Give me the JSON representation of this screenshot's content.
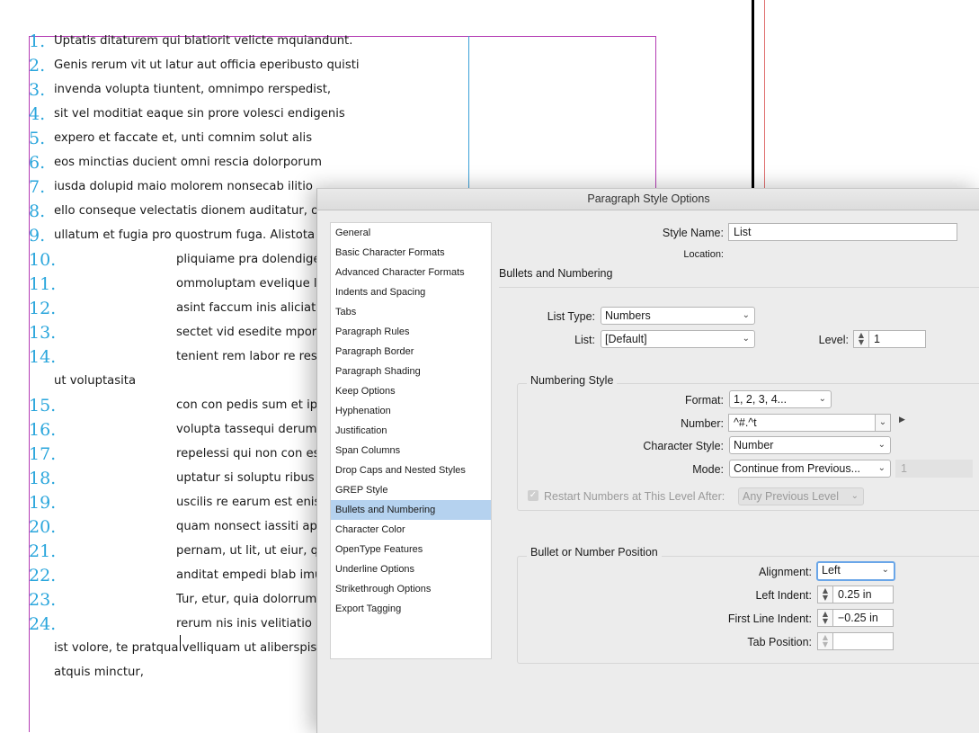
{
  "document": {
    "list_items": [
      {
        "number": "1.",
        "text": "Uptatis ditaturem qui blatiorit velicte mquiandunt."
      },
      {
        "number": "2.",
        "text": "Genis rerum vit ut latur aut officia eperibusto quisti"
      },
      {
        "number": "3.",
        "text": "invenda volupta tiuntent, omnimpo rerspedist,"
      },
      {
        "number": "4.",
        "text": "sit vel moditiat eaque sin prore volesci endigenis"
      },
      {
        "number": "5.",
        "text": "expero et faccate et, unti comnim solut alis"
      },
      {
        "number": "6.",
        "text": "eos minctias ducient omni rescia dolorporum"
      },
      {
        "number": "7.",
        "text": "iusda dolupid maio molorem nonsecab ilitio"
      },
      {
        "number": "8.",
        "text": "ello conseque velectatis dionem auditatur, o"
      },
      {
        "number": "9.",
        "text": "ullatum et fugia pro quostrum fuga. Alistota"
      },
      {
        "number": "10.",
        "text": "pliquiame pra dolendige"
      },
      {
        "number": "11.",
        "text": "ommoluptam evelique l"
      },
      {
        "number": "12.",
        "text": "asint faccum inis aliciat"
      },
      {
        "number": "13.",
        "text": "sectet vid esedite mporc"
      },
      {
        "number": "14.",
        "text": "tenient rem labor re res"
      },
      {
        "number": "",
        "text": "ut voluptasita"
      },
      {
        "number": "15.",
        "text": "con con pedis sum et ips"
      },
      {
        "number": "16.",
        "text": "volupta tassequi derum"
      },
      {
        "number": "17.",
        "text": "repelessi qui non con es"
      },
      {
        "number": "18.",
        "text": "uptatur si soluptu ribus"
      },
      {
        "number": "19.",
        "text": "uscilis re earum est enis"
      },
      {
        "number": "20.",
        "text": "quam nonsect iassiti ap"
      },
      {
        "number": "21.",
        "text": "pernam, ut lit, ut eiur, qu"
      },
      {
        "number": "22.",
        "text": "anditat empedi blab imu"
      },
      {
        "number": "23.",
        "text": "Tur, etur, quia dolorrum"
      },
      {
        "number": "24.",
        "text": "rerum nis inis velitiatio"
      },
      {
        "number": "",
        "text": "ist volore, te pratqua velliquam ut aliberspis"
      },
      {
        "number": "",
        "text": "atquis minctur,"
      }
    ]
  },
  "dialog": {
    "title": "Paragraph Style Options",
    "sidebar_items": [
      "General",
      "Basic Character Formats",
      "Advanced Character Formats",
      "Indents and Spacing",
      "Tabs",
      "Paragraph Rules",
      "Paragraph Border",
      "Paragraph Shading",
      "Keep Options",
      "Hyphenation",
      "Justification",
      "Span Columns",
      "Drop Caps and Nested Styles",
      "GREP Style",
      "Bullets and Numbering",
      "Character Color",
      "OpenType Features",
      "Underline Options",
      "Strikethrough Options",
      "Export Tagging"
    ],
    "selected_index": 14,
    "style_name_label": "Style Name:",
    "style_name_value": "List",
    "location_label": "Location:",
    "section_heading": "Bullets and Numbering",
    "list_type_label": "List Type:",
    "list_type_value": "Numbers",
    "list_label": "List:",
    "list_value": "[Default]",
    "level_label": "Level:",
    "level_value": "1",
    "numbering_style": {
      "heading": "Numbering Style",
      "format_label": "Format:",
      "format_value": "1, 2, 3, 4...",
      "number_label": "Number:",
      "number_value": "^#.^t",
      "char_style_label": "Character Style:",
      "char_style_value": "Number",
      "mode_label": "Mode:",
      "mode_value": "Continue from Previous...",
      "mode_number": "1",
      "restart_label": "Restart Numbers at This Level After:",
      "restart_value": "Any Previous Level",
      "restart_checked": true
    },
    "position": {
      "heading": "Bullet or Number Position",
      "alignment_label": "Alignment:",
      "alignment_value": "Left",
      "left_indent_label": "Left Indent:",
      "left_indent_value": "0.25 in",
      "first_line_label": "First Line Indent:",
      "first_line_value": "−0.25 in",
      "tab_position_label": "Tab Position:",
      "tab_position_value": ""
    }
  },
  "icons": {
    "chevron_down": "⌄",
    "triangle_right": "▶",
    "spinner": "˄˅",
    "check": "✓"
  },
  "colors": {
    "number_color": "#2aa6dc",
    "frame_color": "#b43cb4",
    "selection_color": "#b5d2ef"
  }
}
